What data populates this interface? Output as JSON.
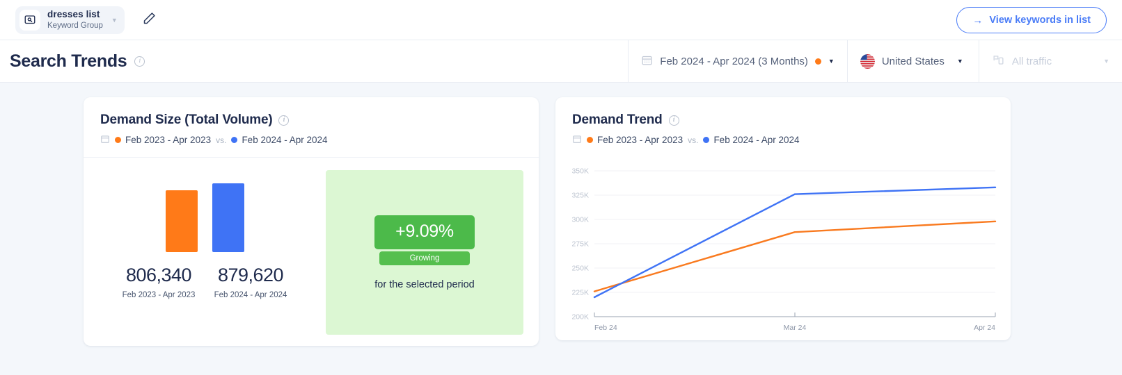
{
  "topbar": {
    "group_name": "dresses list",
    "group_type": "Keyword Group",
    "group_icon": "keyword-group-icon",
    "caret_icon": "chevron-down-icon",
    "edit_icon": "pencil-icon",
    "view_button": {
      "label": "View keywords in list",
      "icon": "arrow-right-icon"
    }
  },
  "subbar": {
    "title": "Search Trends",
    "info_icon": "info-icon",
    "date_range": {
      "label": "Feb 2024 - Apr 2024 (3 Months)",
      "icon": "calendar-icon",
      "dot_color": "#ff7a18"
    },
    "country": {
      "label": "United States",
      "icon": "us-flag-icon"
    },
    "traffic": {
      "label": "All traffic",
      "icon": "traffic-channel-icon",
      "disabled": true
    }
  },
  "demand_size": {
    "title": "Demand Size (Total Volume)",
    "info_icon": "info-icon",
    "calendar_icon": "calendar-icon",
    "legend": {
      "prev_label": "Feb 2023 - Apr 2023",
      "vs": "vs.",
      "curr_label": "Feb 2024 - Apr 2024"
    },
    "colors": {
      "prev": "#ff7a18",
      "curr": "#3f73f5",
      "growth_bg": "#dcf7d3",
      "growth_badge": "#4cba4a"
    },
    "bars": [
      {
        "value": "806,340",
        "label": "Feb 2023 - Apr 2023",
        "raw": 806340
      },
      {
        "value": "879,620",
        "label": "Feb 2024 - Apr 2024",
        "raw": 879620
      }
    ],
    "growth": {
      "percent": "+9.09%",
      "status": "Growing",
      "caption": "for the selected period"
    }
  },
  "demand_trend": {
    "title": "Demand Trend",
    "info_icon": "info-icon",
    "calendar_icon": "calendar-icon",
    "legend": {
      "prev_label": "Feb 2023 - Apr 2023",
      "vs": "vs.",
      "curr_label": "Feb 2024 - Apr 2024"
    }
  },
  "chart_data": {
    "type": "line",
    "title": "Demand Trend",
    "xlabel": "",
    "ylabel": "",
    "categories": [
      "Feb 24",
      "Mar 24",
      "Apr 24"
    ],
    "x_tick_labels": [
      "Feb 24",
      "Mar 24",
      "Apr 24"
    ],
    "y_tick_labels": [
      "200K",
      "225K",
      "250K",
      "275K",
      "300K",
      "325K",
      "350K"
    ],
    "y_tick_values": [
      200000,
      225000,
      250000,
      275000,
      300000,
      325000,
      350000
    ],
    "ylim": [
      200000,
      350000
    ],
    "grid": true,
    "legend_position": "top-left",
    "series": [
      {
        "name": "Feb 2023 - Apr 2023",
        "color": "#f97a1f",
        "values": [
          226000,
          287000,
          298000
        ]
      },
      {
        "name": "Feb 2024 - Apr 2024",
        "color": "#3f73f5",
        "values": [
          220000,
          326000,
          333000
        ]
      }
    ]
  }
}
